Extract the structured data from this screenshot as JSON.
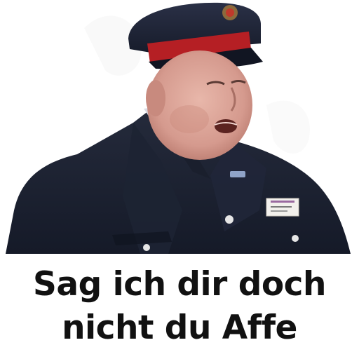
{
  "caption": {
    "line1": "Sag ich dir doch",
    "line2": "nicht du Affe"
  },
  "colors": {
    "uniform": "#1c2233",
    "cap_band": "#b51f24",
    "skin": "#d9a49a",
    "caption_text": "#111111",
    "background": "#ffffff"
  }
}
